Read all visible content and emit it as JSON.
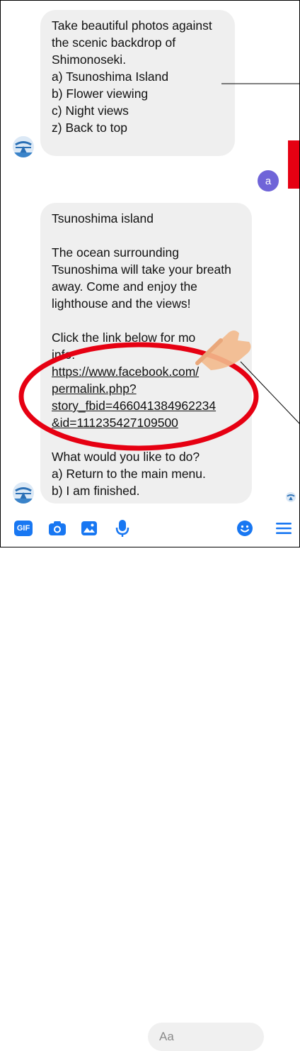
{
  "messages": [
    {
      "sender": "bot",
      "lines": [
        "Take beautiful photos against",
        "the scenic backdrop of",
        "Shimonoseki.",
        "",
        "a) Tsunoshima Island",
        "b) Flower viewing",
        "c) Night views",
        "z) Back to top"
      ]
    },
    {
      "sender": "bot",
      "lines_top": [
        "Tsunoshima island",
        "",
        "The ocean surrounding",
        "Tsunoshima will take your breath",
        "away. Come and enjoy the",
        "lighthouse and the views!",
        "",
        "Click the link below for mo",
        "info:"
      ],
      "link_lines": [
        "https://www.facebook.com/",
        "permalink.php?",
        "story_fbid=466041384962234",
        "&id=111235427109500"
      ],
      "lines_bottom": [
        "What would you like to do?",
        "a) Return to the main menu.",
        "b) I am finished."
      ]
    }
  ],
  "user_avatar": {
    "letter": "a",
    "color": "#6f64d8"
  },
  "composer": {
    "placeholder": "Aa"
  },
  "toolbar": {
    "icons": [
      "gif-icon",
      "camera-icon",
      "image-icon",
      "microphone-icon",
      "emoji-icon",
      "menu-icon"
    ],
    "gif_label": "GIF",
    "accent": "#1877f2"
  },
  "annotation": {
    "highlight_color": "#e60012"
  }
}
